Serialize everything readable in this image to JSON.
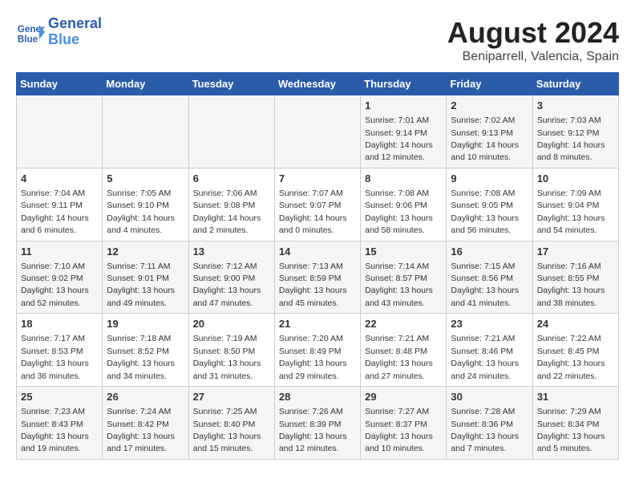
{
  "header": {
    "logo_line1": "General",
    "logo_line2": "Blue",
    "main_title": "August 2024",
    "subtitle": "Beniparrell, Valencia, Spain"
  },
  "weekdays": [
    "Sunday",
    "Monday",
    "Tuesday",
    "Wednesday",
    "Thursday",
    "Friday",
    "Saturday"
  ],
  "weeks": [
    [
      {
        "day": "",
        "info": ""
      },
      {
        "day": "",
        "info": ""
      },
      {
        "day": "",
        "info": ""
      },
      {
        "day": "",
        "info": ""
      },
      {
        "day": "1",
        "info": "Sunrise: 7:01 AM\nSunset: 9:14 PM\nDaylight: 14 hours\nand 12 minutes."
      },
      {
        "day": "2",
        "info": "Sunrise: 7:02 AM\nSunset: 9:13 PM\nDaylight: 14 hours\nand 10 minutes."
      },
      {
        "day": "3",
        "info": "Sunrise: 7:03 AM\nSunset: 9:12 PM\nDaylight: 14 hours\nand 8 minutes."
      }
    ],
    [
      {
        "day": "4",
        "info": "Sunrise: 7:04 AM\nSunset: 9:11 PM\nDaylight: 14 hours\nand 6 minutes."
      },
      {
        "day": "5",
        "info": "Sunrise: 7:05 AM\nSunset: 9:10 PM\nDaylight: 14 hours\nand 4 minutes."
      },
      {
        "day": "6",
        "info": "Sunrise: 7:06 AM\nSunset: 9:08 PM\nDaylight: 14 hours\nand 2 minutes."
      },
      {
        "day": "7",
        "info": "Sunrise: 7:07 AM\nSunset: 9:07 PM\nDaylight: 14 hours\nand 0 minutes."
      },
      {
        "day": "8",
        "info": "Sunrise: 7:08 AM\nSunset: 9:06 PM\nDaylight: 13 hours\nand 58 minutes."
      },
      {
        "day": "9",
        "info": "Sunrise: 7:08 AM\nSunset: 9:05 PM\nDaylight: 13 hours\nand 56 minutes."
      },
      {
        "day": "10",
        "info": "Sunrise: 7:09 AM\nSunset: 9:04 PM\nDaylight: 13 hours\nand 54 minutes."
      }
    ],
    [
      {
        "day": "11",
        "info": "Sunrise: 7:10 AM\nSunset: 9:02 PM\nDaylight: 13 hours\nand 52 minutes."
      },
      {
        "day": "12",
        "info": "Sunrise: 7:11 AM\nSunset: 9:01 PM\nDaylight: 13 hours\nand 49 minutes."
      },
      {
        "day": "13",
        "info": "Sunrise: 7:12 AM\nSunset: 9:00 PM\nDaylight: 13 hours\nand 47 minutes."
      },
      {
        "day": "14",
        "info": "Sunrise: 7:13 AM\nSunset: 8:59 PM\nDaylight: 13 hours\nand 45 minutes."
      },
      {
        "day": "15",
        "info": "Sunrise: 7:14 AM\nSunset: 8:57 PM\nDaylight: 13 hours\nand 43 minutes."
      },
      {
        "day": "16",
        "info": "Sunrise: 7:15 AM\nSunset: 8:56 PM\nDaylight: 13 hours\nand 41 minutes."
      },
      {
        "day": "17",
        "info": "Sunrise: 7:16 AM\nSunset: 8:55 PM\nDaylight: 13 hours\nand 38 minutes."
      }
    ],
    [
      {
        "day": "18",
        "info": "Sunrise: 7:17 AM\nSunset: 8:53 PM\nDaylight: 13 hours\nand 36 minutes."
      },
      {
        "day": "19",
        "info": "Sunrise: 7:18 AM\nSunset: 8:52 PM\nDaylight: 13 hours\nand 34 minutes."
      },
      {
        "day": "20",
        "info": "Sunrise: 7:19 AM\nSunset: 8:50 PM\nDaylight: 13 hours\nand 31 minutes."
      },
      {
        "day": "21",
        "info": "Sunrise: 7:20 AM\nSunset: 8:49 PM\nDaylight: 13 hours\nand 29 minutes."
      },
      {
        "day": "22",
        "info": "Sunrise: 7:21 AM\nSunset: 8:48 PM\nDaylight: 13 hours\nand 27 minutes."
      },
      {
        "day": "23",
        "info": "Sunrise: 7:21 AM\nSunset: 8:46 PM\nDaylight: 13 hours\nand 24 minutes."
      },
      {
        "day": "24",
        "info": "Sunrise: 7:22 AM\nSunset: 8:45 PM\nDaylight: 13 hours\nand 22 minutes."
      }
    ],
    [
      {
        "day": "25",
        "info": "Sunrise: 7:23 AM\nSunset: 8:43 PM\nDaylight: 13 hours\nand 19 minutes."
      },
      {
        "day": "26",
        "info": "Sunrise: 7:24 AM\nSunset: 8:42 PM\nDaylight: 13 hours\nand 17 minutes."
      },
      {
        "day": "27",
        "info": "Sunrise: 7:25 AM\nSunset: 8:40 PM\nDaylight: 13 hours\nand 15 minutes."
      },
      {
        "day": "28",
        "info": "Sunrise: 7:26 AM\nSunset: 8:39 PM\nDaylight: 13 hours\nand 12 minutes."
      },
      {
        "day": "29",
        "info": "Sunrise: 7:27 AM\nSunset: 8:37 PM\nDaylight: 13 hours\nand 10 minutes."
      },
      {
        "day": "30",
        "info": "Sunrise: 7:28 AM\nSunset: 8:36 PM\nDaylight: 13 hours\nand 7 minutes."
      },
      {
        "day": "31",
        "info": "Sunrise: 7:29 AM\nSunset: 8:34 PM\nDaylight: 13 hours\nand 5 minutes."
      }
    ]
  ]
}
